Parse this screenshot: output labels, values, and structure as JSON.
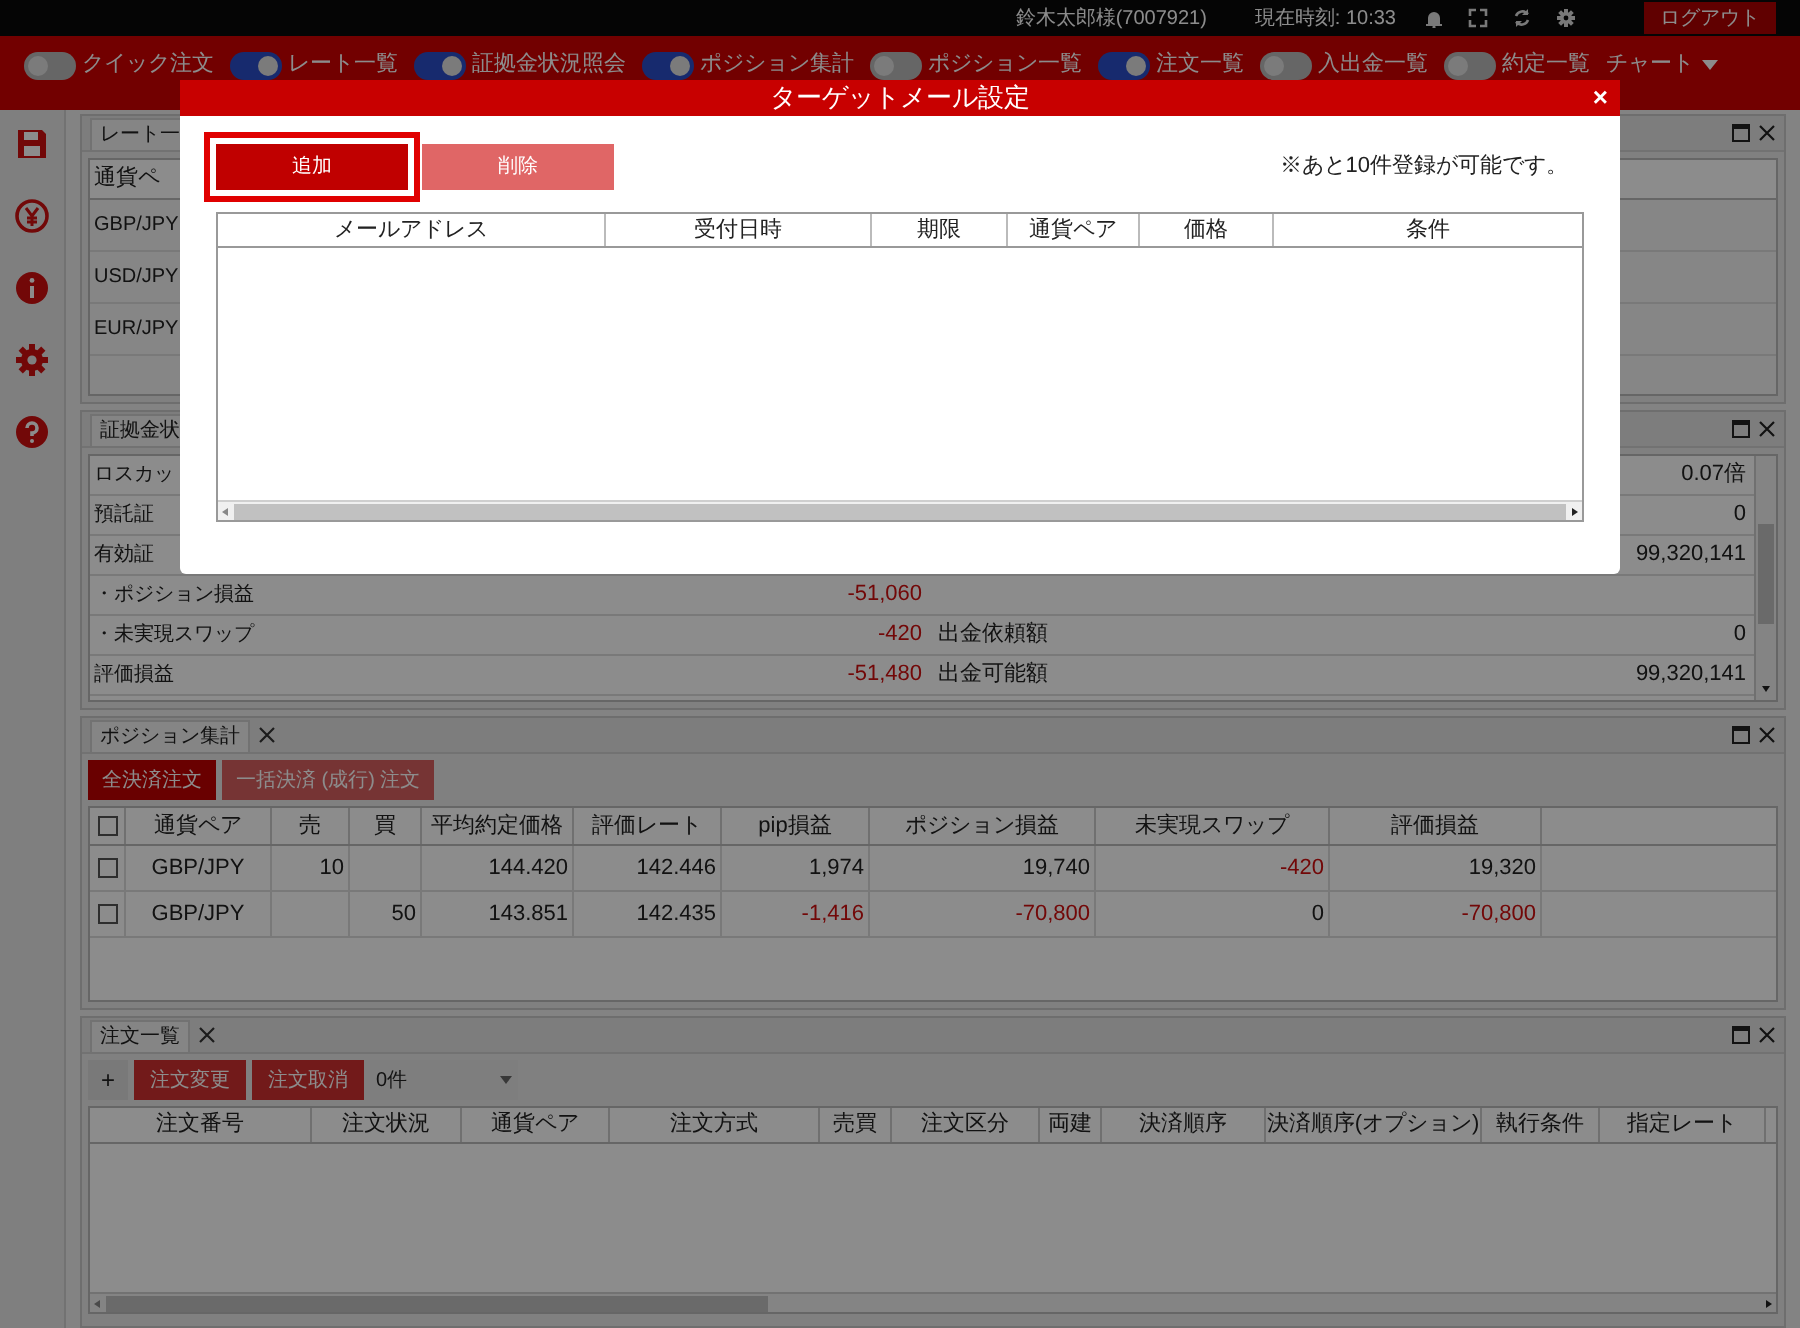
{
  "top_bar": {
    "user": "鈴木太郎様(7007921)",
    "clock": "現在時刻: 10:33",
    "logout": "ログアウト"
  },
  "toolbar": [
    {
      "label": "クイック注文",
      "on": false
    },
    {
      "label": "レート一覧",
      "on": true
    },
    {
      "label": "証拠金状況照会",
      "on": true
    },
    {
      "label": "ポジション集計",
      "on": true
    },
    {
      "label": "ポジション一覧",
      "on": false
    },
    {
      "label": "注文一覧",
      "on": true
    },
    {
      "label": "入出金一覧",
      "on": false
    },
    {
      "label": "約定一覧",
      "on": false
    }
  ],
  "chart_menu": "チャート",
  "rate_panel": {
    "title": "レート一",
    "column_1": "通貨ペ",
    "rows": [
      "GBP/JPY",
      "USD/JPY",
      "EUR/JPY"
    ]
  },
  "margin_panel": {
    "title": "証拠金状",
    "rows": [
      {
        "label": "ロスカッ",
        "value_2": "0.07倍"
      },
      {
        "label": "預託証",
        "value_2": "0"
      },
      {
        "label": "有効証",
        "value_2": "99,320,141"
      },
      {
        "label": "・ポジション損益",
        "value": "-51,060",
        "value_negative": true
      },
      {
        "label": "・未実現スワップ",
        "value": "-420",
        "value_negative": true,
        "label_2": "出金依頼額",
        "value_2": "0"
      },
      {
        "label": "評価損益",
        "value": "-51,480",
        "value_negative": true,
        "label_2": "出金可能額",
        "value_2": "99,320,141"
      }
    ]
  },
  "position_panel": {
    "title": "ポジション集計",
    "buttons": [
      {
        "label": "全決済注文",
        "disabled": false
      },
      {
        "label": "一括決済 (成行) 注文",
        "disabled": true
      }
    ],
    "columns": [
      "通貨ペア",
      "売",
      "買",
      "平均約定価格",
      "評価レート",
      "pip損益",
      "ポジション損益",
      "未実現スワップ",
      "評価損益"
    ],
    "header_checked": false,
    "rows": [
      {
        "checked": false,
        "cells": [
          {
            "text": "GBP/JPY",
            "negative": false
          },
          {
            "text": "10",
            "negative": false
          },
          null,
          {
            "text": "144.420",
            "negative": false
          },
          {
            "text": "142.446",
            "negative": false
          },
          {
            "text": "1,974",
            "negative": false
          },
          {
            "text": "19,740",
            "negative": false
          },
          {
            "text": "-420",
            "negative": true
          },
          {
            "text": "19,320",
            "negative": false
          }
        ]
      },
      {
        "checked": false,
        "cells": [
          {
            "text": "GBP/JPY",
            "negative": false
          },
          null,
          {
            "text": "50",
            "negative": false
          },
          {
            "text": "143.851",
            "negative": false
          },
          {
            "text": "142.435",
            "negative": false
          },
          {
            "text": "-1,416",
            "negative": true
          },
          {
            "text": "-70,800",
            "negative": true
          },
          {
            "text": "0",
            "negative": false
          },
          {
            "text": "-70,800",
            "negative": true
          }
        ]
      }
    ]
  },
  "order_panel": {
    "title": "注文一覧",
    "add": "+",
    "buttons": [
      "注文変更",
      "注文取消"
    ],
    "count_select": "0件",
    "columns": [
      "注文番号",
      "注文状況",
      "通貨ペア",
      "注文方式",
      "売買",
      "注文区分",
      "両建",
      "決済順序",
      "決済順序(オプション)",
      "執行条件",
      "指定レート"
    ]
  },
  "dialog": {
    "title": "ターゲットメール設定",
    "close": "×",
    "buttons": [
      {
        "label": "追加",
        "selected": true
      },
      {
        "label": "削除",
        "selected": false
      }
    ],
    "notice": "※あと10件登録が可能です。",
    "columns": [
      "メールアドレス",
      "受付日時",
      "期限",
      "通貨ペア",
      "価格",
      "条件"
    ]
  }
}
